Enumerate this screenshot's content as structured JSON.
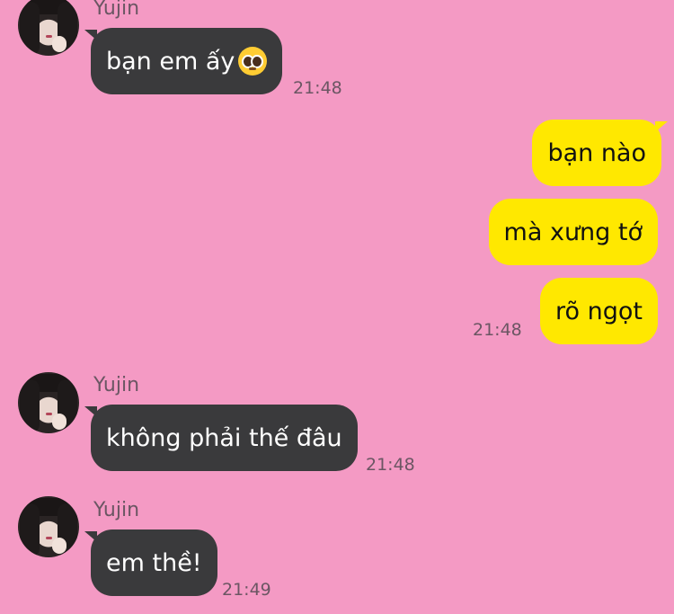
{
  "colors": {
    "background": "#f49ac4",
    "incoming_bubble": "#3a3a3c",
    "outgoing_bubble": "#ffe800"
  },
  "messages": [
    {
      "sender": "Yujin",
      "text": "bạn em ấy",
      "emoji": "pleading-face-emoji",
      "time": "21:48"
    },
    {
      "sender": "me",
      "text": "bạn nào"
    },
    {
      "sender": "me",
      "text": "mà xưng tớ"
    },
    {
      "sender": "me",
      "text": "rõ ngọt",
      "time": "21:48"
    },
    {
      "sender": "Yujin",
      "text": "không phải thế đâu",
      "time": "21:48"
    },
    {
      "sender": "Yujin",
      "text": "em thề!",
      "time": "21:49"
    }
  ]
}
